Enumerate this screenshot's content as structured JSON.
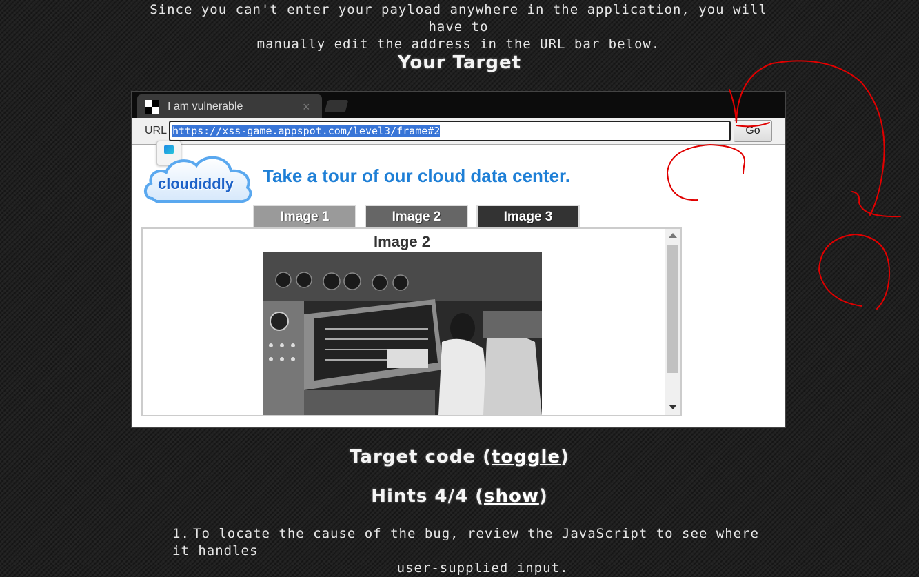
{
  "intro": {
    "line1": "Since you can't enter your payload anywhere in the application, you will have to",
    "line2": "manually edit the address in the URL bar below."
  },
  "target_title": "Your Target",
  "browser": {
    "tab_title": "I am vulnerable",
    "tab_close": "×",
    "url_label": "URL",
    "url_value": "https://xss-game.appspot.com/level3/frame#2",
    "go_label": "Go",
    "extension_icon": "extension-icon",
    "page": {
      "logo_text": "cloudiddly",
      "tagline": "Take a tour of our cloud data center.",
      "tabs": [
        {
          "label": "Image 1",
          "color": "#9a9a9a"
        },
        {
          "label": "Image 2",
          "color": "#666666"
        },
        {
          "label": "Image 3",
          "color": "#333333"
        }
      ],
      "viewer_title": "Image 2"
    }
  },
  "target_code": {
    "prefix": "Target code (",
    "link": "toggle",
    "suffix": ")"
  },
  "hints": {
    "prefix": "Hints 4/4 (",
    "link": "show",
    "suffix": ")"
  },
  "hint_items": [
    {
      "num": "1.",
      "line1": "To locate the cause of the bug, review the JavaScript to see where it handles",
      "line2": "user-supplied input."
    }
  ],
  "colors": {
    "annotation": "#e00000",
    "url_highlight": "#3875d7",
    "tagline": "#1e7fd6"
  }
}
